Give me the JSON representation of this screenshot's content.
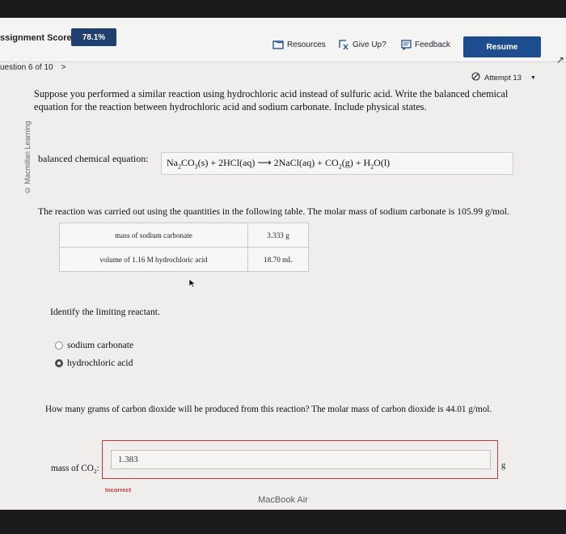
{
  "header": {
    "score_label": "ssignment Score:",
    "score_value": "78.1%",
    "resources_label": "Resources",
    "giveup_label": "Give Up?",
    "feedback_label": "Feedback",
    "resume_label": "Resume"
  },
  "nav": {
    "question_label": "uestion 6 of 10",
    "next_glyph": ">"
  },
  "attempt": {
    "label": "Attempt 13"
  },
  "sidebar_credit": "© Macmillan Learning",
  "question": {
    "prompt": "Suppose you performed a similar reaction using hydrochloric acid instead of sulfuric acid. Write the balanced chemical equation for the reaction between hydrochloric acid and sodium carbonate. Include physical states.",
    "equation_label": "balanced chemical equation:",
    "equation": {
      "na2co3_a": "Na",
      "na2co3_sub2": "2",
      "na2co3_b": "CO",
      "na2co3_sub3": "3",
      "na2co3_state": "(s) + 2HCl(aq)",
      "arrow": "⟶",
      "nacl": "2NaCl(aq) + CO",
      "co2_sub": "2",
      "co2_state": "(g) + H",
      "h2o_sub": "2",
      "h2o_state": "O(l)"
    },
    "reaction_text": "The reaction was carried out using the quantities in the following table. The molar mass of sodium carbonate is 105.99 g/mol.",
    "table": [
      {
        "label": "mass of sodium carbonate",
        "value": "3.333 g"
      },
      {
        "label": "volume of 1.16 M hydrochloric acid",
        "value": "18.70 mL"
      }
    ],
    "limiting_question": "Identify the limiting reactant.",
    "options": [
      {
        "label": "sodium carbonate",
        "selected": false
      },
      {
        "label": "hydrochloric acid",
        "selected": true
      }
    ],
    "co2_question": "How many grams of carbon dioxide will be produced from this reaction? The molar mass of carbon dioxide is 44.01 g/mol.",
    "mass_label_prefix": "mass of CO",
    "mass_label_sub": "2",
    "mass_label_suffix": ":",
    "answer_value": "1.383",
    "unit": "g",
    "status": "Incorrect"
  },
  "bezel_label": "MacBook Air",
  "colors": {
    "accent": "#1d4d8e",
    "error": "#c23b3b"
  }
}
